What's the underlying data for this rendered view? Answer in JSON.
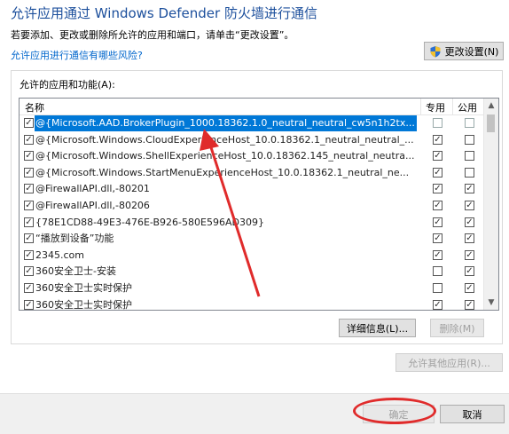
{
  "header": {
    "title": "允许应用通过 Windows Defender 防火墙进行通信",
    "subtitle": "若要添加、更改或删除所允许的应用和端口，请单击“更改设置”。",
    "risk_link": "允许应用进行通信有哪些风险?",
    "change_settings": "更改设置(N)"
  },
  "apps": {
    "group_label": "允许的应用和功能(A):",
    "columns": {
      "name": "名称",
      "private": "专用",
      "public": "公用"
    },
    "rows": [
      {
        "name": "@{Microsoft.AAD.BrokerPlugin_1000.18362.1.0_neutral_neutral_cw5n1h2tx...",
        "enabled": true,
        "private": false,
        "public": false,
        "selected": true
      },
      {
        "name": "@{Microsoft.Windows.CloudExperienceHost_10.0.18362.1_neutral_neutral_...",
        "enabled": true,
        "private": true,
        "public": false
      },
      {
        "name": "@{Microsoft.Windows.ShellExperienceHost_10.0.18362.145_neutral_neutra...",
        "enabled": true,
        "private": true,
        "public": false
      },
      {
        "name": "@{Microsoft.Windows.StartMenuExperienceHost_10.0.18362.1_neutral_ne...",
        "enabled": true,
        "private": true,
        "public": false
      },
      {
        "name": "@FirewallAPI.dll,-80201",
        "enabled": true,
        "private": true,
        "public": true
      },
      {
        "name": "@FirewallAPI.dll,-80206",
        "enabled": true,
        "private": true,
        "public": true
      },
      {
        "name": "{78E1CD88-49E3-476E-B926-580E596AD309}",
        "enabled": true,
        "private": true,
        "public": true
      },
      {
        "name": "“播放到设备”功能",
        "enabled": true,
        "private": true,
        "public": true
      },
      {
        "name": "2345.com",
        "enabled": true,
        "private": true,
        "public": true
      },
      {
        "name": "360安全卫士-安装",
        "enabled": true,
        "private": false,
        "public": true
      },
      {
        "name": "360安全卫士实时保护",
        "enabled": true,
        "private": false,
        "public": true
      },
      {
        "name": "360安全卫士实时保护",
        "enabled": true,
        "private": true,
        "public": true
      }
    ],
    "details_button": "详细信息(L)...",
    "delete_button": "删除(M)"
  },
  "allow_other_button": "允许其他应用(R)...",
  "footer": {
    "ok": "确定",
    "cancel": "取消"
  },
  "colors": {
    "title": "#1c4f9c",
    "link": "#0066cc",
    "selection": "#0078d7",
    "annotation": "#e02b2b"
  },
  "icons": {
    "change_settings": "uac-shield-icon"
  }
}
